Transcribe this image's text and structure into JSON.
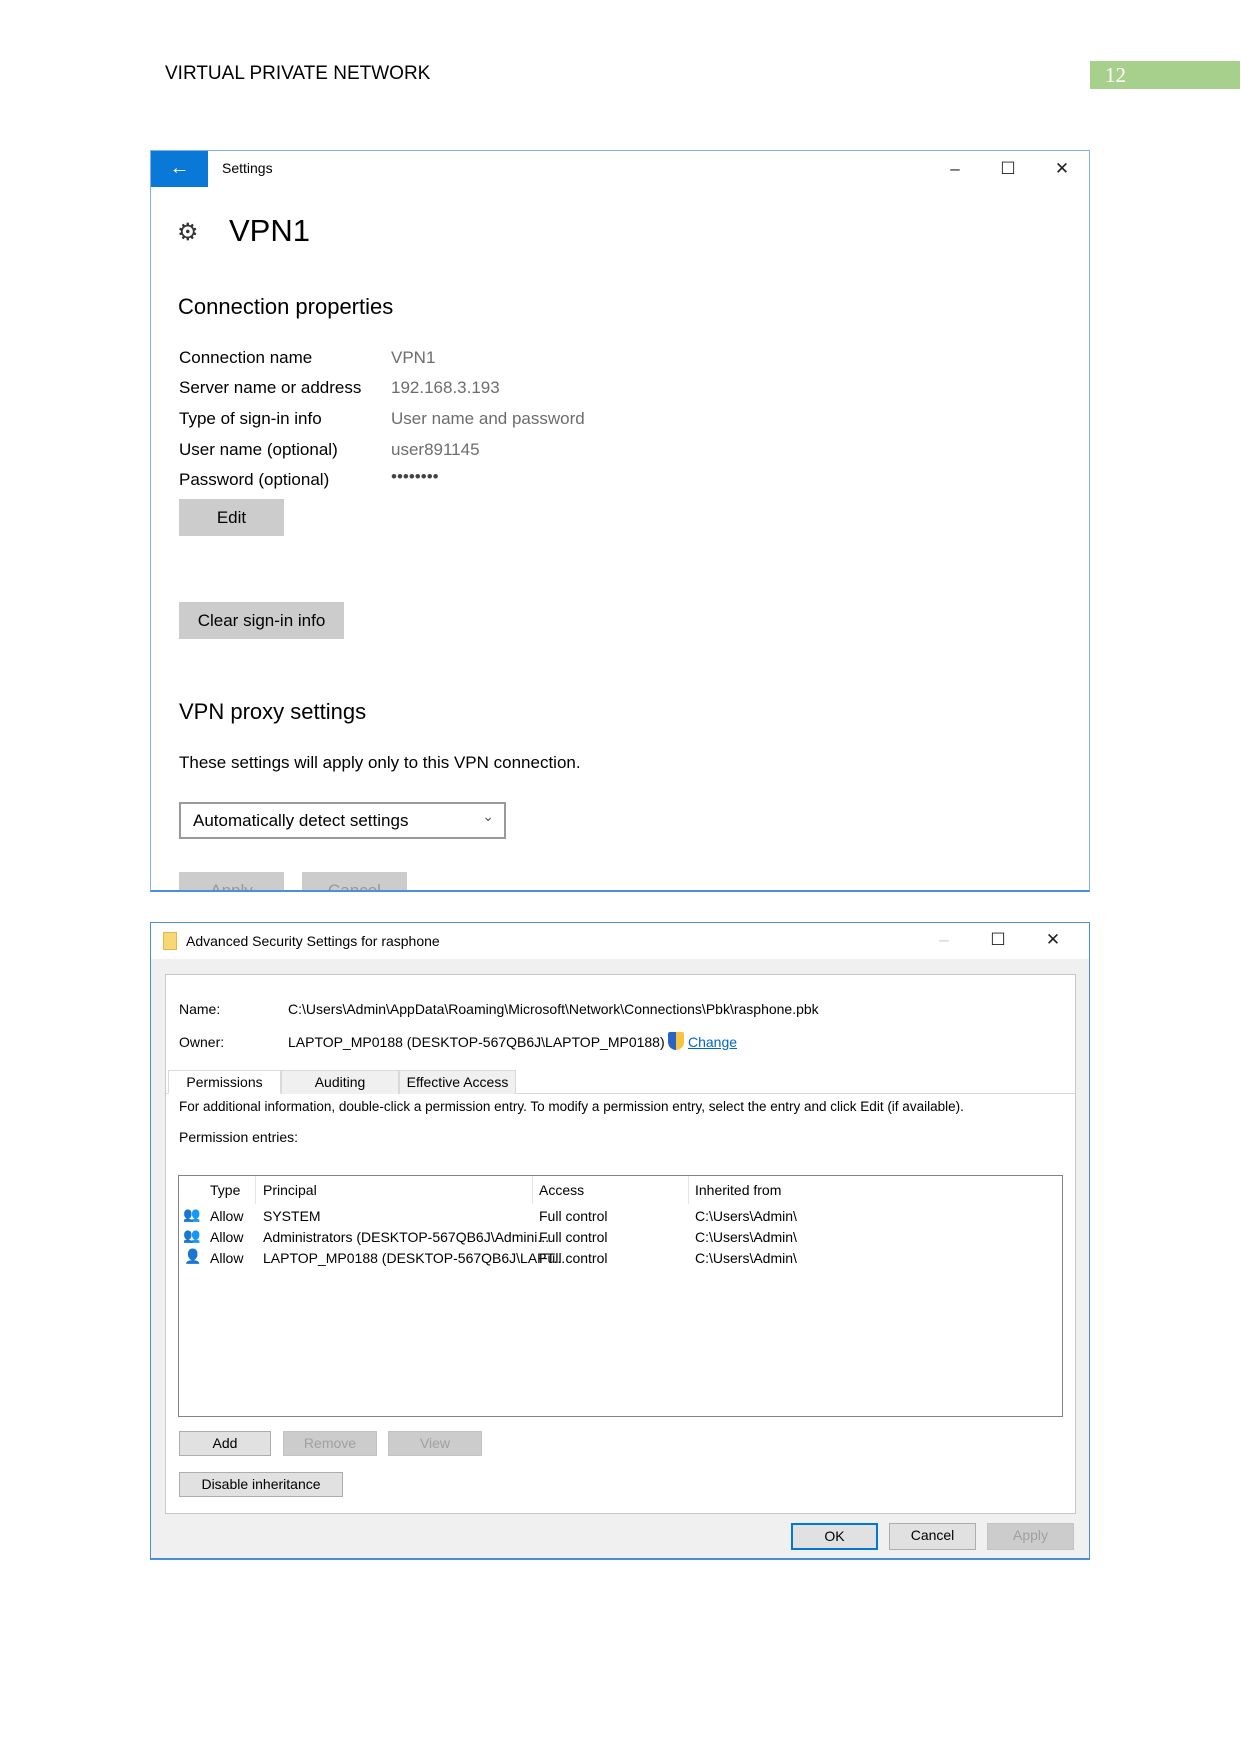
{
  "document": {
    "header": "VIRTUAL PRIVATE NETWORK",
    "page_number": "12"
  },
  "settings_window": {
    "title": "Settings",
    "page_title": "VPN1",
    "section_connection": "Connection properties",
    "properties": [
      {
        "label": "Connection name",
        "value": "VPN1"
      },
      {
        "label": "Server name or address",
        "value": "192.168.3.193"
      },
      {
        "label": "Type of sign-in info",
        "value": "User name and password"
      },
      {
        "label": "User name (optional)",
        "value": "user891145"
      },
      {
        "label": "Password (optional)",
        "value": "••••••••"
      }
    ],
    "edit_label": "Edit",
    "clear_label": "Clear sign-in info",
    "section_proxy": "VPN proxy settings",
    "proxy_note": "These settings will apply only to this VPN connection.",
    "proxy_select": "Automatically detect settings",
    "apply_label": "Apply",
    "cancel_label": "Cancel"
  },
  "security_window": {
    "title": "Advanced Security Settings for rasphone",
    "name_label": "Name:",
    "name_value": "C:\\Users\\Admin\\AppData\\Roaming\\Microsoft\\Network\\Connections\\Pbk\\rasphone.pbk",
    "owner_label": "Owner:",
    "owner_value": "LAPTOP_MP0188 (DESKTOP-567QB6J\\LAPTOP_MP0188)",
    "change_label": "Change",
    "tabs": [
      "Permissions",
      "Auditing",
      "Effective Access"
    ],
    "info": "For additional information, double-click a permission entry. To modify a permission entry, select the entry and click Edit (if available).",
    "entries_label": "Permission entries:",
    "columns": [
      "Type",
      "Principal",
      "Access",
      "Inherited from"
    ],
    "rows": [
      {
        "icon": "group-icon",
        "type": "Allow",
        "principal": "SYSTEM",
        "access": "Full control",
        "inherited": "C:\\Users\\Admin\\"
      },
      {
        "icon": "group-icon",
        "type": "Allow",
        "principal": "Administrators (DESKTOP-567QB6J\\Admini...",
        "access": "Full control",
        "inherited": "C:\\Users\\Admin\\"
      },
      {
        "icon": "user-icon",
        "type": "Allow",
        "principal": "LAPTOP_MP0188 (DESKTOP-567QB6J\\LAPT...",
        "access": "Full control",
        "inherited": "C:\\Users\\Admin\\"
      }
    ],
    "add_label": "Add",
    "remove_label": "Remove",
    "view_label": "View",
    "disable_inheritance_label": "Disable inheritance",
    "ok_label": "OK",
    "cancel_label": "Cancel",
    "apply_label": "Apply"
  },
  "colors": {
    "accent": "#0a78d7",
    "page_tab": "#a8d08d",
    "link": "#0066cc"
  }
}
